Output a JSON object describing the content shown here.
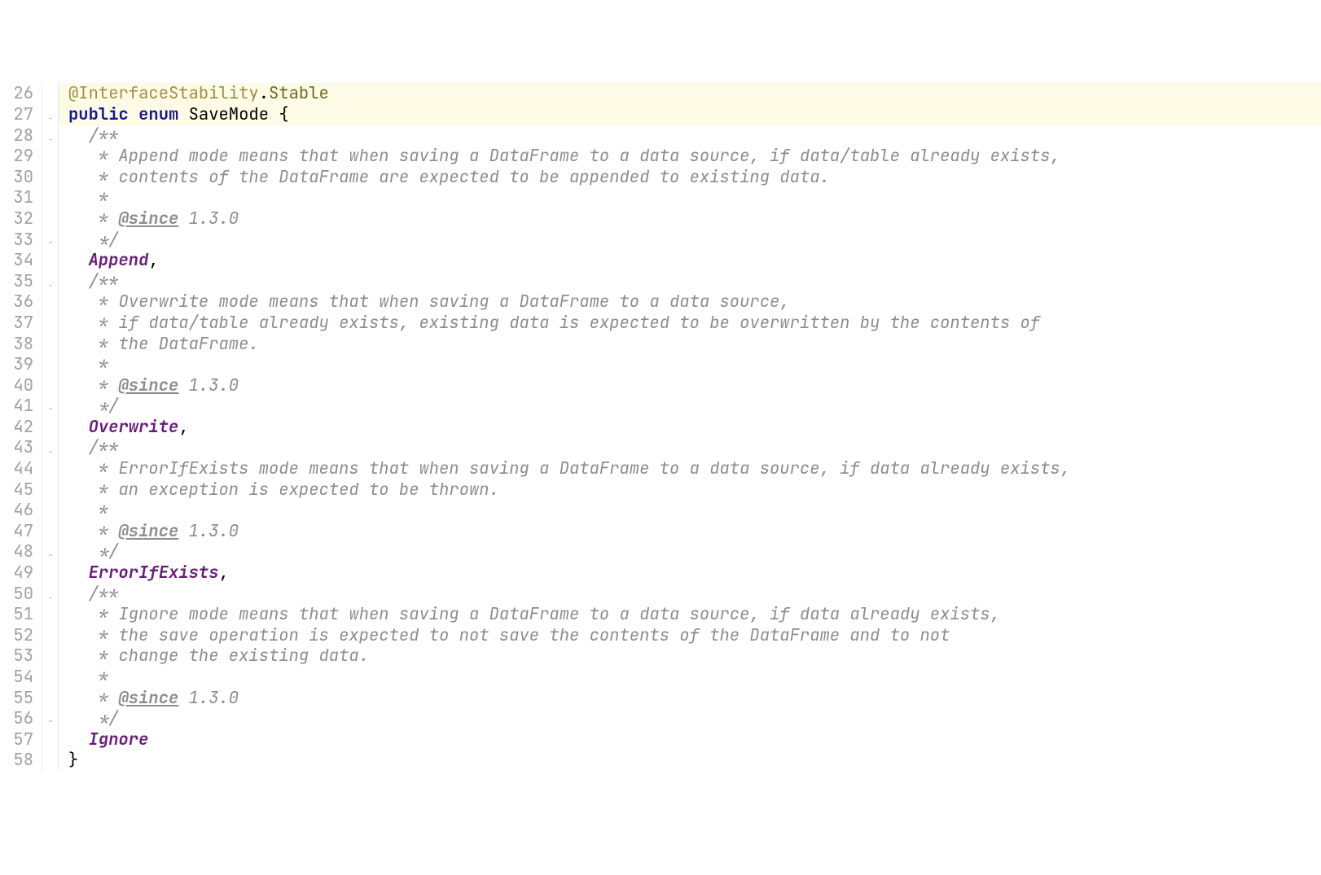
{
  "lines": [
    {
      "num": "26",
      "fold": "",
      "hl": true,
      "tokens": [
        {
          "cls": "annot",
          "t": "@InterfaceStability"
        },
        {
          "cls": "punct",
          "t": "."
        },
        {
          "cls": "olive",
          "t": "Stable"
        }
      ]
    },
    {
      "num": "27",
      "fold": "−",
      "hl": true,
      "tokens": [
        {
          "cls": "keyword",
          "t": "public enum "
        },
        {
          "cls": "enum-name",
          "t": "SaveMode"
        },
        {
          "cls": "punct",
          "t": " {"
        }
      ]
    },
    {
      "num": "28",
      "fold": "−",
      "hl": false,
      "tokens": [
        {
          "cls": "comment",
          "t": "  /**"
        }
      ]
    },
    {
      "num": "29",
      "fold": "",
      "hl": false,
      "tokens": [
        {
          "cls": "comment",
          "t": "   * Append mode means that when saving a DataFrame to a data source, if data/table already exists,"
        }
      ]
    },
    {
      "num": "30",
      "fold": "",
      "hl": false,
      "tokens": [
        {
          "cls": "comment",
          "t": "   * contents of the DataFrame are expected to be appended to existing data."
        }
      ]
    },
    {
      "num": "31",
      "fold": "",
      "hl": false,
      "tokens": [
        {
          "cls": "comment",
          "t": "   *"
        }
      ]
    },
    {
      "num": "32",
      "fold": "",
      "hl": false,
      "tokens": [
        {
          "cls": "comment",
          "t": "   * "
        },
        {
          "cls": "comment tag",
          "t": "@since"
        },
        {
          "cls": "comment",
          "t": " 1.3.0"
        }
      ]
    },
    {
      "num": "33",
      "fold": "⌃",
      "hl": false,
      "tokens": [
        {
          "cls": "comment",
          "t": "   */"
        }
      ]
    },
    {
      "num": "34",
      "fold": "",
      "hl": false,
      "tokens": [
        {
          "cls": "punct",
          "t": "  "
        },
        {
          "cls": "enum-const",
          "t": "Append"
        },
        {
          "cls": "punct",
          "t": ","
        }
      ]
    },
    {
      "num": "35",
      "fold": "−",
      "hl": false,
      "tokens": [
        {
          "cls": "comment",
          "t": "  /**"
        }
      ]
    },
    {
      "num": "36",
      "fold": "",
      "hl": false,
      "tokens": [
        {
          "cls": "comment",
          "t": "   * Overwrite mode means that when saving a DataFrame to a data source,"
        }
      ]
    },
    {
      "num": "37",
      "fold": "",
      "hl": false,
      "tokens": [
        {
          "cls": "comment",
          "t": "   * if data/table already exists, existing data is expected to be overwritten by the contents of"
        }
      ]
    },
    {
      "num": "38",
      "fold": "",
      "hl": false,
      "tokens": [
        {
          "cls": "comment",
          "t": "   * the DataFrame."
        }
      ]
    },
    {
      "num": "39",
      "fold": "",
      "hl": false,
      "tokens": [
        {
          "cls": "comment",
          "t": "   *"
        }
      ]
    },
    {
      "num": "40",
      "fold": "",
      "hl": false,
      "tokens": [
        {
          "cls": "comment",
          "t": "   * "
        },
        {
          "cls": "comment tag",
          "t": "@since"
        },
        {
          "cls": "comment",
          "t": " 1.3.0"
        }
      ]
    },
    {
      "num": "41",
      "fold": "⌃",
      "hl": false,
      "tokens": [
        {
          "cls": "comment",
          "t": "   */"
        }
      ]
    },
    {
      "num": "42",
      "fold": "",
      "hl": false,
      "tokens": [
        {
          "cls": "punct",
          "t": "  "
        },
        {
          "cls": "enum-const",
          "t": "Overwrite"
        },
        {
          "cls": "punct",
          "t": ","
        }
      ]
    },
    {
      "num": "43",
      "fold": "−",
      "hl": false,
      "tokens": [
        {
          "cls": "comment",
          "t": "  /**"
        }
      ]
    },
    {
      "num": "44",
      "fold": "",
      "hl": false,
      "tokens": [
        {
          "cls": "comment",
          "t": "   * ErrorIfExists mode means that when saving a DataFrame to a data source, if data already exists,"
        }
      ]
    },
    {
      "num": "45",
      "fold": "",
      "hl": false,
      "tokens": [
        {
          "cls": "comment",
          "t": "   * an exception is expected to be thrown."
        }
      ]
    },
    {
      "num": "46",
      "fold": "",
      "hl": false,
      "tokens": [
        {
          "cls": "comment",
          "t": "   *"
        }
      ]
    },
    {
      "num": "47",
      "fold": "",
      "hl": false,
      "tokens": [
        {
          "cls": "comment",
          "t": "   * "
        },
        {
          "cls": "comment tag",
          "t": "@since"
        },
        {
          "cls": "comment",
          "t": " 1.3.0"
        }
      ]
    },
    {
      "num": "48",
      "fold": "⌃",
      "hl": false,
      "tokens": [
        {
          "cls": "comment",
          "t": "   */"
        }
      ]
    },
    {
      "num": "49",
      "fold": "",
      "hl": false,
      "tokens": [
        {
          "cls": "punct",
          "t": "  "
        },
        {
          "cls": "enum-const",
          "t": "ErrorIfExists"
        },
        {
          "cls": "punct",
          "t": ","
        }
      ]
    },
    {
      "num": "50",
      "fold": "−",
      "hl": false,
      "tokens": [
        {
          "cls": "comment",
          "t": "  /**"
        }
      ]
    },
    {
      "num": "51",
      "fold": "",
      "hl": false,
      "tokens": [
        {
          "cls": "comment",
          "t": "   * Ignore mode means that when saving a DataFrame to a data source, if data already exists,"
        }
      ]
    },
    {
      "num": "52",
      "fold": "",
      "hl": false,
      "tokens": [
        {
          "cls": "comment",
          "t": "   * the save operation is expected to not save the contents of the DataFrame and to not"
        }
      ]
    },
    {
      "num": "53",
      "fold": "",
      "hl": false,
      "tokens": [
        {
          "cls": "comment",
          "t": "   * change the existing data."
        }
      ]
    },
    {
      "num": "54",
      "fold": "",
      "hl": false,
      "tokens": [
        {
          "cls": "comment",
          "t": "   *"
        }
      ]
    },
    {
      "num": "55",
      "fold": "",
      "hl": false,
      "tokens": [
        {
          "cls": "comment",
          "t": "   * "
        },
        {
          "cls": "comment tag",
          "t": "@since"
        },
        {
          "cls": "comment",
          "t": " 1.3.0"
        }
      ]
    },
    {
      "num": "56",
      "fold": "⌃",
      "hl": false,
      "tokens": [
        {
          "cls": "comment",
          "t": "   */"
        }
      ]
    },
    {
      "num": "57",
      "fold": "",
      "hl": false,
      "tokens": [
        {
          "cls": "punct",
          "t": "  "
        },
        {
          "cls": "enum-const",
          "t": "Ignore"
        }
      ]
    },
    {
      "num": "58",
      "fold": "",
      "hl": false,
      "tokens": [
        {
          "cls": "punct",
          "t": "}"
        }
      ]
    }
  ]
}
